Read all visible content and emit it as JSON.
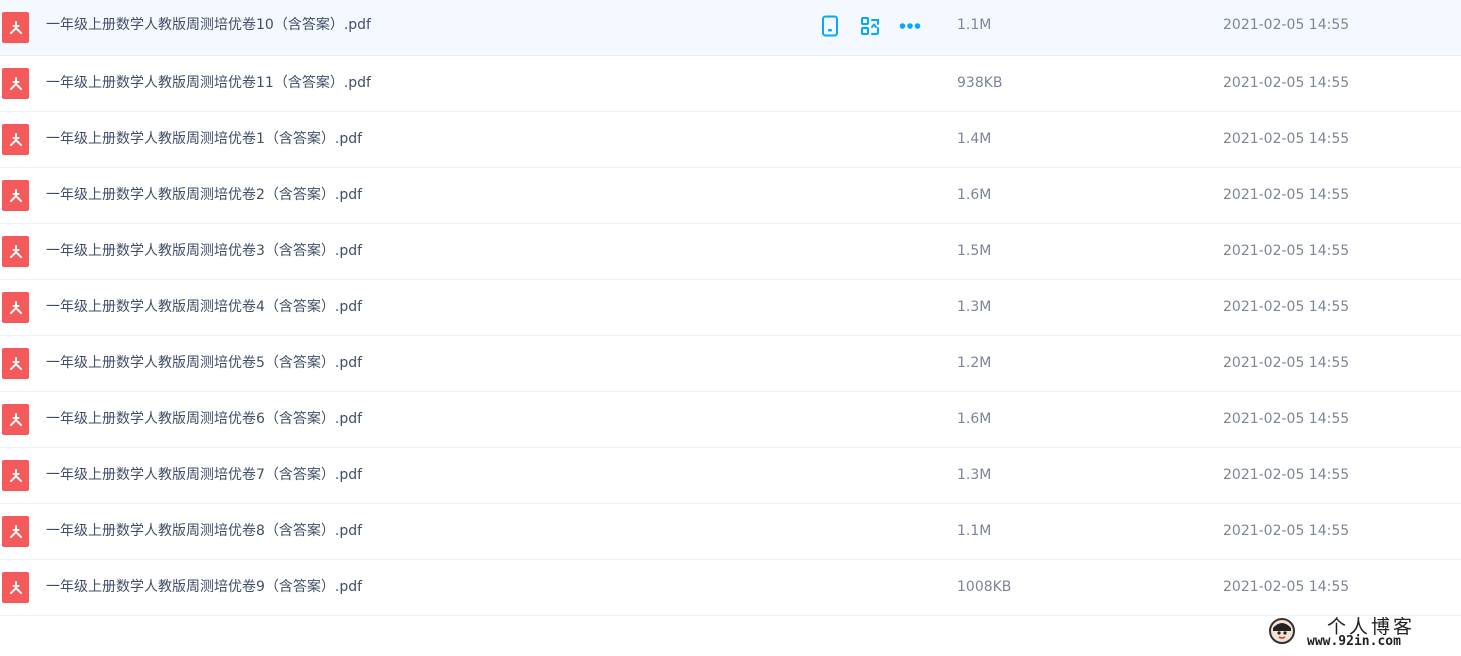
{
  "files": [
    {
      "name": "一年级上册数学人教版周测培优卷10（含答案）.pdf",
      "size": "1.1M",
      "time": "2021-02-05 14:55",
      "hovered": true
    },
    {
      "name": "一年级上册数学人教版周测培优卷11（含答案）.pdf",
      "size": "938KB",
      "time": "2021-02-05 14:55"
    },
    {
      "name": "一年级上册数学人教版周测培优卷1（含答案）.pdf",
      "size": "1.4M",
      "time": "2021-02-05 14:55"
    },
    {
      "name": "一年级上册数学人教版周测培优卷2（含答案）.pdf",
      "size": "1.6M",
      "time": "2021-02-05 14:55"
    },
    {
      "name": "一年级上册数学人教版周测培优卷3（含答案）.pdf",
      "size": "1.5M",
      "time": "2021-02-05 14:55"
    },
    {
      "name": "一年级上册数学人教版周测培优卷4（含答案）.pdf",
      "size": "1.3M",
      "time": "2021-02-05 14:55"
    },
    {
      "name": "一年级上册数学人教版周测培优卷5（含答案）.pdf",
      "size": "1.2M",
      "time": "2021-02-05 14:55"
    },
    {
      "name": "一年级上册数学人教版周测培优卷6（含答案）.pdf",
      "size": "1.6M",
      "time": "2021-02-05 14:55"
    },
    {
      "name": "一年级上册数学人教版周测培优卷7（含答案）.pdf",
      "size": "1.3M",
      "time": "2021-02-05 14:55"
    },
    {
      "name": "一年级上册数学人教版周测培优卷8（含答案）.pdf",
      "size": "1.1M",
      "time": "2021-02-05 14:55"
    },
    {
      "name": "一年级上册数学人教版周测培优卷9（含答案）.pdf",
      "size": "1008KB",
      "time": "2021-02-05 14:55"
    }
  ],
  "row_actions": [
    {
      "icon": "phone-icon"
    },
    {
      "icon": "share-icon"
    },
    {
      "icon": "more-icon"
    }
  ],
  "colors": {
    "pdf_icon": "#f45a5a",
    "action_icon": "#06a7ff",
    "hover_row": "#f3f9fe",
    "text": "#424e67",
    "meta_text": "#7d8596"
  },
  "watermark": {
    "title": "个人博客",
    "url": "www.92in.com"
  }
}
